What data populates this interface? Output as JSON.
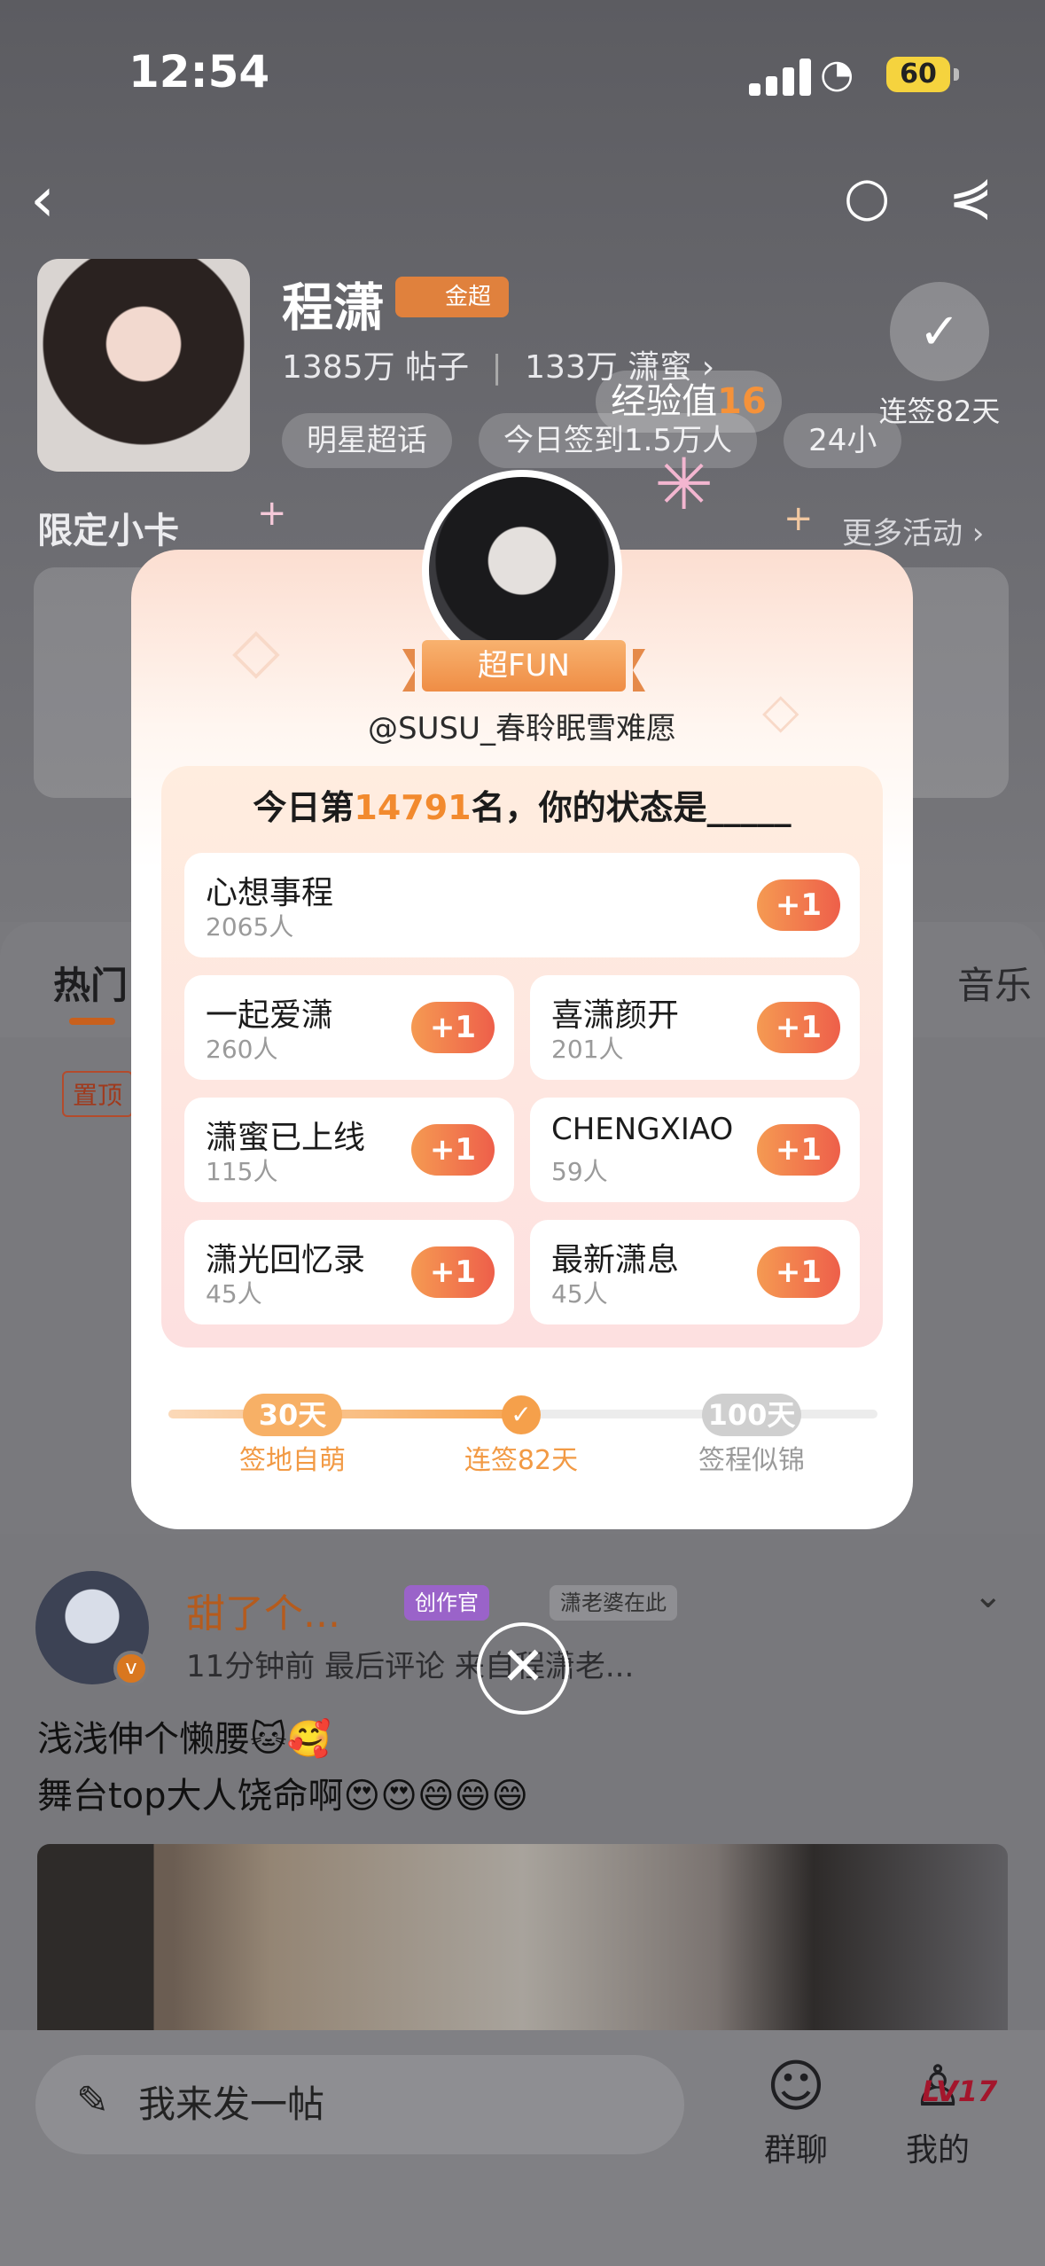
{
  "status": {
    "time": "12:54",
    "battery": "60"
  },
  "topic": {
    "name": "程潇",
    "badge": "金超",
    "posts": "1385万",
    "posts_label": "帖子",
    "members": "133万",
    "members_label": "潇蜜",
    "chips": [
      "明星超话",
      "今日签到1.5万人",
      "24小"
    ],
    "checkin": "连签82天",
    "exp_label": "经验值",
    "exp_value": "16"
  },
  "section": {
    "limited": "限定小卡",
    "more": "更多活动 ›"
  },
  "tabs": {
    "hot": "热门",
    "music": "音乐"
  },
  "pinned": "置顶",
  "modal": {
    "ribbon": "超FUN",
    "user": "@SUSU_春聆眠雪难愿",
    "rank_prefix": "今日第",
    "rank": "14791",
    "rank_suffix": "名，你的状态是_____",
    "options": [
      {
        "label": "心想事程",
        "count": "2065人"
      },
      {
        "label": "一起爱潇",
        "count": "260人"
      },
      {
        "label": "喜潇颜开",
        "count": "201人"
      },
      {
        "label": "潇蜜已上线",
        "count": "115人"
      },
      {
        "label": "CHENGXIAO",
        "count": "59人"
      },
      {
        "label": "潇光回忆录",
        "count": "45人"
      },
      {
        "label": "最新潇息",
        "count": "45人"
      }
    ],
    "plus": "+1",
    "progress": {
      "nodes": [
        {
          "pill": "30天",
          "label": "签地自萌"
        },
        {
          "pill": "",
          "label": "连签82天"
        },
        {
          "pill": "100天",
          "label": "签程似锦"
        }
      ],
      "fraction": 0.5
    }
  },
  "post": {
    "author": "甜了个...",
    "tag_creator": "创作官",
    "tag_fan": "潇老婆在此",
    "meta": "11分钟前 最后评论  来自程潇老...",
    "line1": "浅浅伸个懒腰🐱🥰",
    "line2": "舞台top大人饶命啊😍😍😄😄😄"
  },
  "bottom": {
    "compose": "我来发一帖",
    "group": "群聊",
    "mine": "我的",
    "level": "LV17"
  },
  "colors": {
    "accent": "#F28A2E",
    "plus_start": "#F59A52",
    "plus_end": "#EE5F4A"
  }
}
